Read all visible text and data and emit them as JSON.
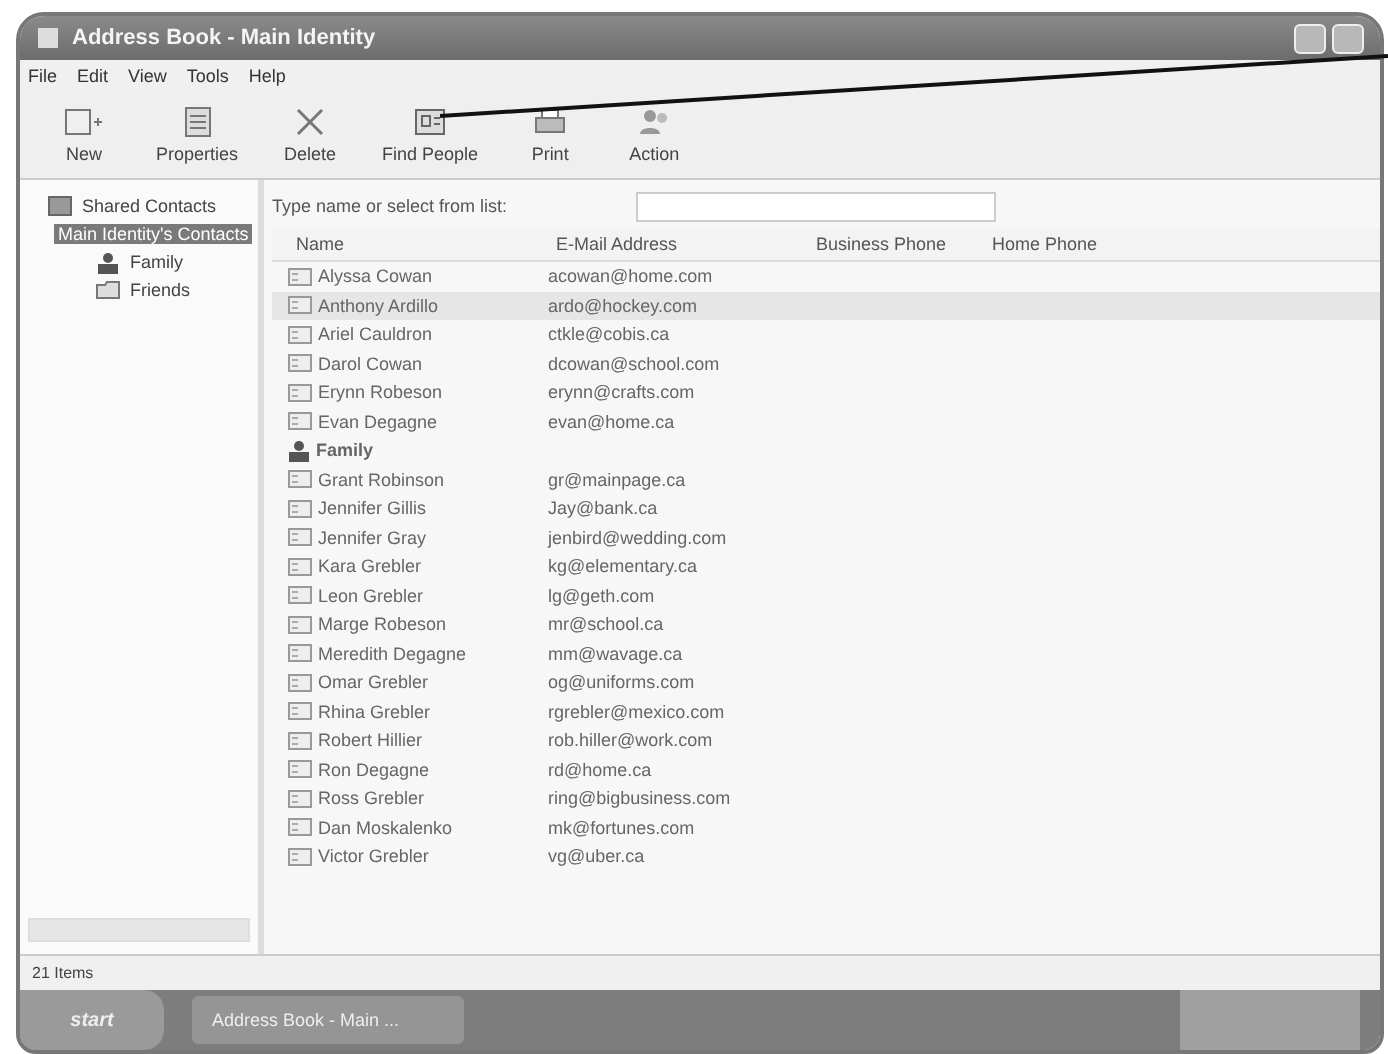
{
  "window": {
    "title": "Address Book - Main Identity"
  },
  "menu": [
    "File",
    "Edit",
    "View",
    "Tools",
    "Help"
  ],
  "toolbar": [
    {
      "label": "New",
      "kind": "new"
    },
    {
      "label": "Properties",
      "kind": "properties"
    },
    {
      "label": "Delete",
      "kind": "delete"
    },
    {
      "label": "Find People",
      "kind": "find"
    },
    {
      "label": "Print",
      "kind": "print"
    },
    {
      "label": "Action",
      "kind": "action"
    }
  ],
  "sidebar": {
    "items": [
      {
        "label": "Shared Contacts",
        "kind": "shared",
        "selected": false
      },
      {
        "label": "Main Identity's Contacts",
        "kind": "folder",
        "selected": true,
        "children": [
          {
            "label": "Family",
            "kind": "group",
            "selected": false
          },
          {
            "label": "Friends",
            "kind": "folder",
            "selected": false
          }
        ]
      }
    ]
  },
  "search": {
    "label": "Type name or select from list:"
  },
  "table": {
    "columns": [
      "Name",
      "E-Mail Address",
      "Business Phone",
      "Home Phone"
    ],
    "rows": [
      {
        "kind": "contact",
        "name": "Alyssa Cowan",
        "email": "acowan@home.com",
        "selected": false
      },
      {
        "kind": "contact",
        "name": "Anthony Ardillo",
        "email": "ardo@hockey.com",
        "selected": true
      },
      {
        "kind": "contact",
        "name": "Ariel Cauldron",
        "email": "ctkle@cobis.ca",
        "selected": false
      },
      {
        "kind": "contact",
        "name": "Darol Cowan",
        "email": "dcowan@school.com",
        "selected": false
      },
      {
        "kind": "contact",
        "name": "Erynn Robeson",
        "email": "erynn@crafts.com",
        "selected": false
      },
      {
        "kind": "contact",
        "name": "Evan Degagne",
        "email": "evan@home.ca",
        "selected": false
      },
      {
        "kind": "group",
        "name": "Family",
        "selected": false
      },
      {
        "kind": "contact",
        "name": "Grant Robinson",
        "email": "gr@mainpage.ca",
        "selected": false
      },
      {
        "kind": "contact",
        "name": "Jennifer Gillis",
        "email": "Jay@bank.ca",
        "selected": false
      },
      {
        "kind": "contact",
        "name": "Jennifer Gray",
        "email": "jenbird@wedding.com",
        "selected": false
      },
      {
        "kind": "contact",
        "name": "Kara Grebler",
        "email": "kg@elementary.ca",
        "selected": false
      },
      {
        "kind": "contact",
        "name": "Leon Grebler",
        "email": "lg@geth.com",
        "selected": false
      },
      {
        "kind": "contact",
        "name": "Marge Robeson",
        "email": "mr@school.ca",
        "selected": false
      },
      {
        "kind": "contact",
        "name": "Meredith Degagne",
        "email": "mm@wavage.ca",
        "selected": false
      },
      {
        "kind": "contact",
        "name": "Omar Grebler",
        "email": "og@uniforms.com",
        "selected": false
      },
      {
        "kind": "contact",
        "name": "Rhina Grebler",
        "email": "rgrebler@mexico.com",
        "selected": false
      },
      {
        "kind": "contact",
        "name": "Robert Hillier",
        "email": "rob.hiller@work.com",
        "selected": false
      },
      {
        "kind": "contact",
        "name": "Ron Degagne",
        "email": "rd@home.ca",
        "selected": false
      },
      {
        "kind": "contact",
        "name": "Ross Grebler",
        "email": "ring@bigbusiness.com",
        "selected": false
      },
      {
        "kind": "contact",
        "name": "Dan Moskalenko",
        "email": "mk@fortunes.com",
        "selected": false
      },
      {
        "kind": "contact",
        "name": "Victor Grebler",
        "email": "vg@uber.ca",
        "selected": false
      }
    ]
  },
  "status_bar": "21 Items",
  "taskbar": {
    "start": "start",
    "tasks": [
      "Address Book - Main ..."
    ]
  }
}
